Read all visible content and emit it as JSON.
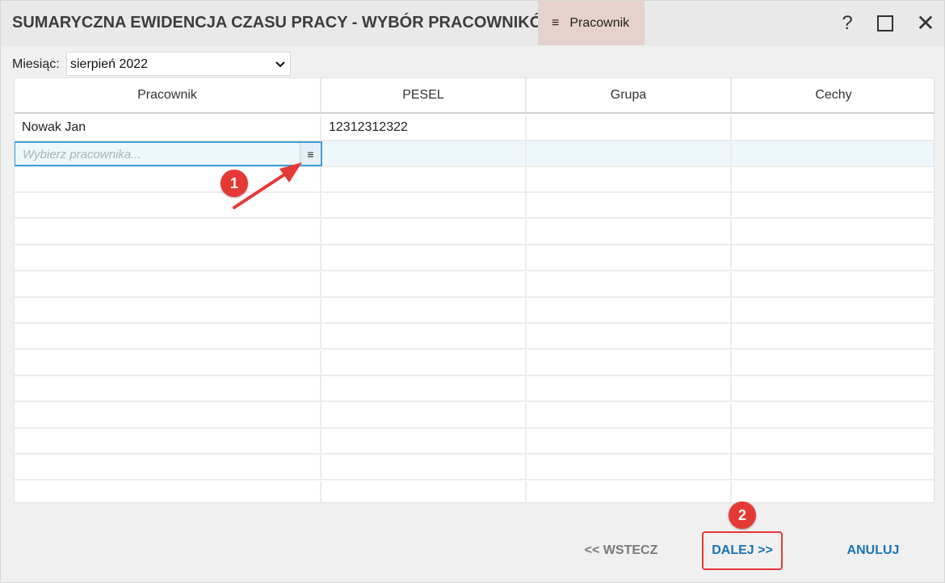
{
  "window": {
    "title": "SUMARYCZNA EWIDENCJA CZASU PRACY - WYBÓR PRACOWNIKÓW",
    "tab_label": "Pracownik",
    "tab_icon": "≡",
    "help_label": "?",
    "close_label": "✕"
  },
  "filter": {
    "month_label": "Miesiąc:",
    "month_value": "sierpień 2022"
  },
  "grid": {
    "columns": [
      "Pracownik",
      "PESEL",
      "Grupa",
      "Cechy"
    ],
    "rows": [
      {
        "pracownik": "Nowak Jan",
        "pesel": "12312312322",
        "grupa": "",
        "cechy": ""
      }
    ],
    "new_row_placeholder": "Wybierz pracownika...",
    "new_row_button_icon": "≡"
  },
  "annotations": {
    "badge_1": "1",
    "badge_2": "2",
    "accent_color": "#e53935"
  },
  "footer": {
    "back_label": "<< WSTECZ",
    "next_label": "DALEJ >>",
    "cancel_label": "ANULUJ"
  },
  "colors": {
    "link_blue": "#1a73b6",
    "focus_border": "#3ba1d6",
    "tab_bg": "#e5d2cc"
  }
}
